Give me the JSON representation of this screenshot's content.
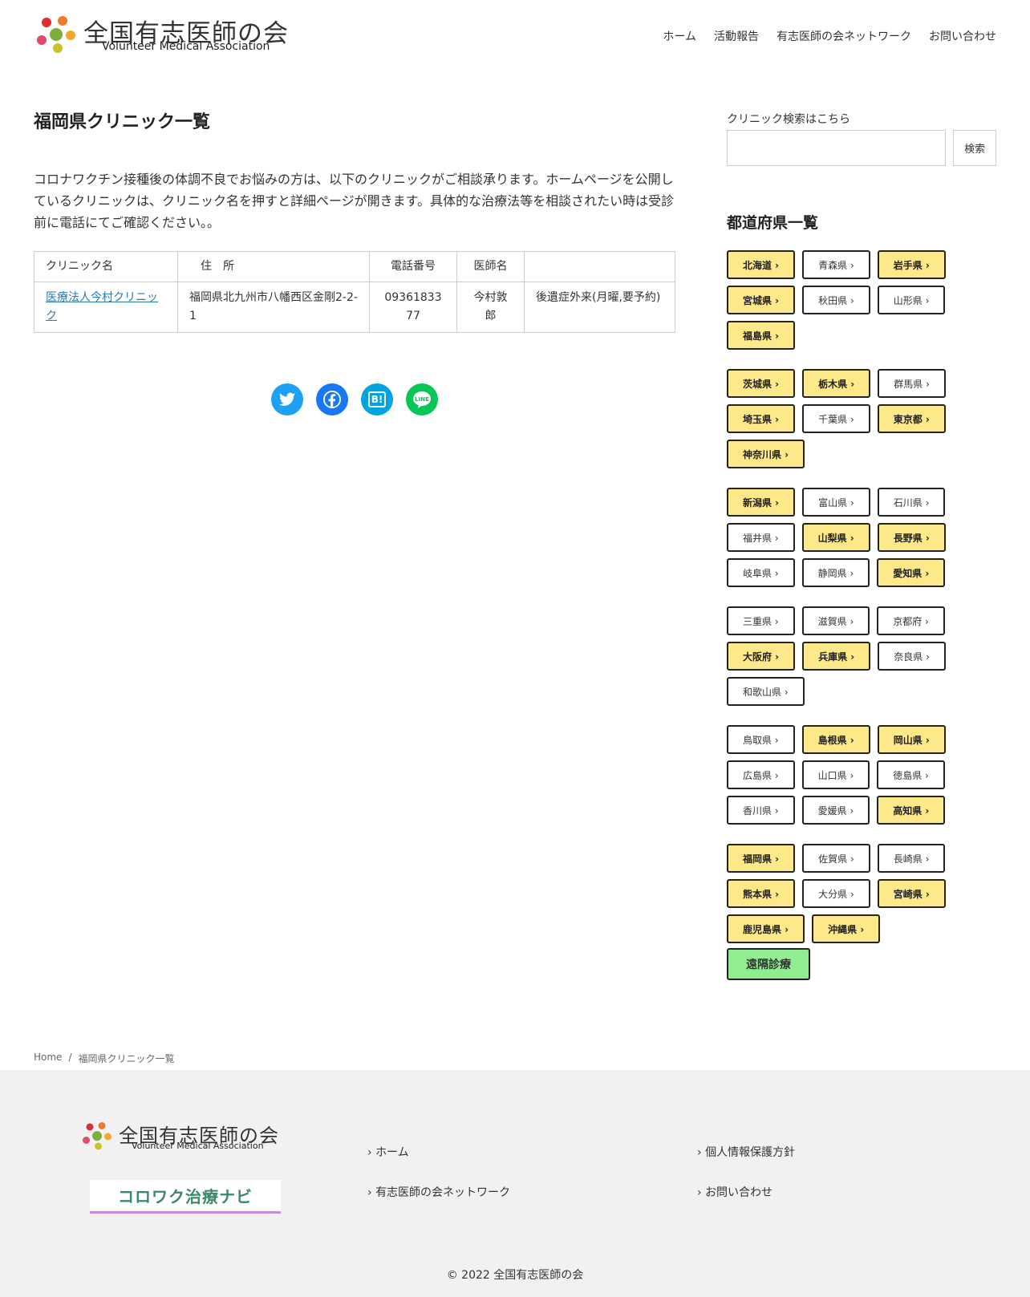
{
  "header": {
    "logo_title": "全国有志医師の会",
    "logo_sub": "Volunteer Medical Association",
    "nav": [
      "ホーム",
      "活動報告",
      "有志医師の会ネットワーク",
      "お問い合わせ"
    ]
  },
  "main": {
    "title": "福岡県クリニック一覧",
    "intro": "コロナワクチン接種後の体調不良でお悩みの方は、以下のクリニックがご相談承ります。ホームページを公開しているクリニックは、クリニック名を押すと詳細ページが開きます。具体的な治療法等を相談されたい時は受診前に電話にてご確認ください。。",
    "table": {
      "headers": [
        "クリニック名",
        "住　所",
        "電話番号",
        "医師名",
        ""
      ],
      "rows": [
        [
          "医療法人今村クリニック",
          "福岡県北九州市八幡西区金剛2-2-1",
          "0936183377",
          "今村敦郎",
          "後遺症外来(月曜,要予約)"
        ]
      ]
    },
    "share": [
      "B!"
    ]
  },
  "sidebar": {
    "search_label": "クリニック検索はこちら",
    "search_button": "検索",
    "pref_title": "都道府県一覧",
    "regions": [
      [
        [
          "北海道 ›",
          1
        ],
        [
          "青森県 ›",
          0
        ],
        [
          "岩手県 ›",
          1
        ],
        [
          "宮城県 ›",
          1
        ],
        [
          "秋田県 ›",
          0
        ],
        [
          "山形県 ›",
          0
        ],
        [
          "福島県 ›",
          1
        ]
      ],
      [
        [
          "茨城県 ›",
          1
        ],
        [
          "栃木県 ›",
          1
        ],
        [
          "群馬県 ›",
          0
        ],
        [
          "埼玉県 ›",
          1
        ],
        [
          "千葉県 ›",
          0
        ],
        [
          "東京都 ›",
          1
        ],
        [
          "神奈川県 ›",
          1
        ]
      ],
      [
        [
          "新潟県 ›",
          1
        ],
        [
          "富山県 ›",
          0
        ],
        [
          "石川県 ›",
          0
        ],
        [
          "福井県 ›",
          0
        ],
        [
          "山梨県 ›",
          1
        ],
        [
          "長野県 ›",
          1
        ],
        [
          "岐阜県 ›",
          0
        ],
        [
          "静岡県 ›",
          0
        ],
        [
          "愛知県 ›",
          1
        ]
      ],
      [
        [
          "三重県 ›",
          0
        ],
        [
          "滋賀県 ›",
          0
        ],
        [
          "京都府 ›",
          0
        ],
        [
          "大阪府 ›",
          1
        ],
        [
          "兵庫県 ›",
          1
        ],
        [
          "奈良県 ›",
          0
        ],
        [
          "和歌山県 ›",
          0
        ]
      ],
      [
        [
          "鳥取県 ›",
          0
        ],
        [
          "島根県 ›",
          1
        ],
        [
          "岡山県 ›",
          1
        ],
        [
          "広島県 ›",
          0
        ],
        [
          "山口県 ›",
          0
        ],
        [
          "徳島県 ›",
          0
        ],
        [
          "香川県 ›",
          0
        ],
        [
          "愛媛県 ›",
          0
        ],
        [
          "高知県 ›",
          1
        ]
      ],
      [
        [
          "福岡県 ›",
          1
        ],
        [
          "佐賀県 ›",
          0
        ],
        [
          "長崎県 ›",
          0
        ],
        [
          "熊本県 ›",
          1
        ],
        [
          "大分県 ›",
          0
        ],
        [
          "宮崎県 ›",
          1
        ],
        [
          "鹿児島県 ›",
          1
        ],
        [
          "沖縄県 ›",
          1
        ],
        [
          "遠隔診療",
          2
        ]
      ]
    ]
  },
  "breadcrumb": {
    "home": "Home",
    "sep": "/",
    "current": "福岡県クリニック一覧"
  },
  "footer": {
    "logo_title": "全国有志医師の会",
    "logo_sub": "Volunteer Medical Association",
    "banner": "コロワク治療ナビ",
    "links_left": [
      "ホーム",
      "有志医師の会ネットワーク"
    ],
    "links_right": [
      "個人情報保護方針",
      "お問い合わせ"
    ],
    "copyright": "© 2022 全国有志医師の会"
  },
  "colors": {
    "active_pref": "#fde98a",
    "remote": "#90ee90",
    "twitter": "#1da1f2",
    "facebook": "#1877f2",
    "hatena": "#00a4de",
    "line": "#06c755"
  }
}
